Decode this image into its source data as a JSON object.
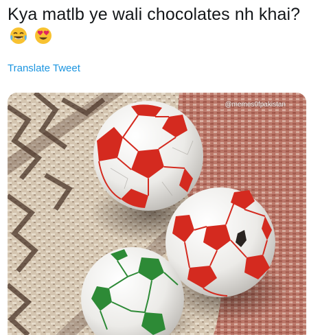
{
  "tweet": {
    "text": "Kya matlb ye wali chocolates nh khai?",
    "emojis": [
      "face-with-tears-of-joy-icon",
      "heart-eyes-icon"
    ]
  },
  "translate_link": "Translate Tweet",
  "media": {
    "watermark": "@memes0fpakistan",
    "colors": {
      "red_ball_accent": "#d42a1f",
      "green_ball_accent": "#2d8a36",
      "foil_white": "#f1f0ee",
      "rug_beige": "#d8cbb7",
      "rug_brown": "#6e5242",
      "rug_red": "#a84a3e"
    }
  }
}
